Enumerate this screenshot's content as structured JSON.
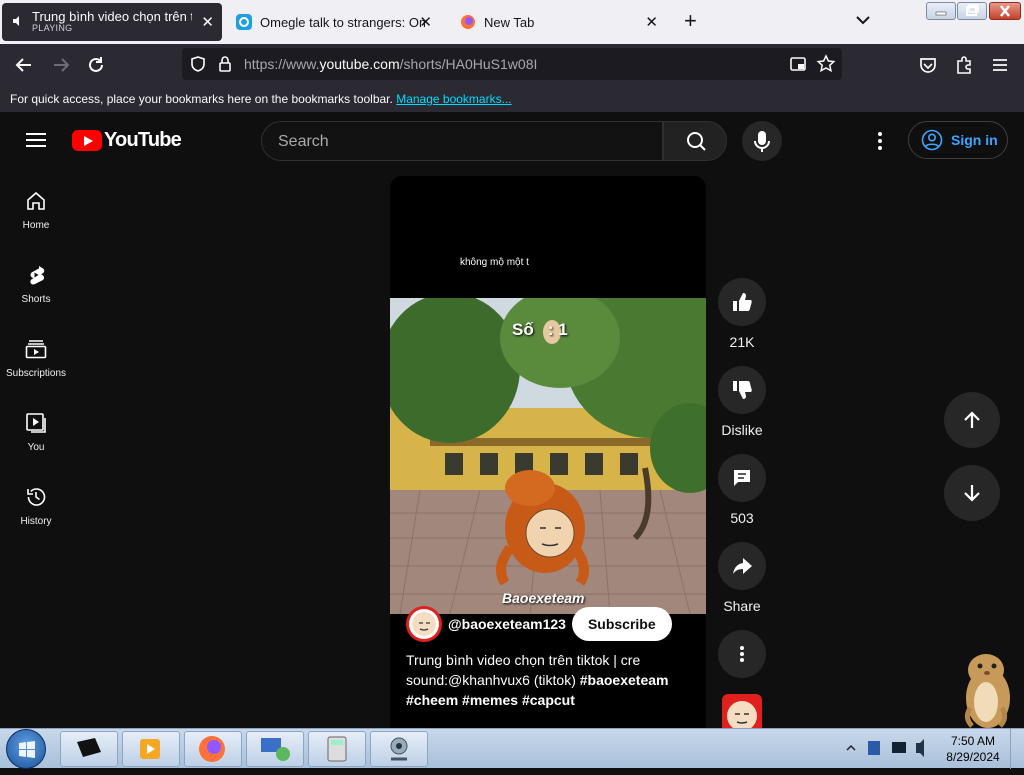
{
  "browser": {
    "tabs": [
      {
        "title": "Trung bình video chọn trên tik",
        "status": "PLAYING",
        "active": true
      },
      {
        "title": "Omegle talk to strangers: Omeg",
        "active": false
      },
      {
        "title": "New Tab",
        "active": false
      }
    ],
    "new_tab_label": "+",
    "url_prefix": "https://www.",
    "url_host": "youtube.com",
    "url_path": "/shorts/HA0HuS1w08I",
    "bookmarks_hint": "For quick access, place your bookmarks here on the bookmarks toolbar.",
    "manage_bookmarks": "Manage bookmarks..."
  },
  "youtube": {
    "logo_text": "YouTube",
    "search_placeholder": "Search",
    "sign_in": "Sign in",
    "sidebar": [
      {
        "label": "Home",
        "icon": "home-icon"
      },
      {
        "label": "Shorts",
        "icon": "shorts-icon"
      },
      {
        "label": "Subscriptions",
        "icon": "subscriptions-icon"
      },
      {
        "label": "You",
        "icon": "you-icon"
      },
      {
        "label": "History",
        "icon": "history-icon"
      }
    ],
    "short": {
      "caption_top": "không mộ một t",
      "score_text": "Số",
      "score_value": ": 1",
      "watermark": "Baoexeteam",
      "channel": "@baoexeteam123",
      "subscribe": "Subscribe",
      "description_text": "Trung bình video chọn trên tiktok | cre sound:@khanhvux6 (tiktok)",
      "hashtags": "#baoexeteam #cheem #memes #capcut"
    },
    "actions": {
      "likes": "21K",
      "dislike": "Dislike",
      "comments": "503",
      "share": "Share"
    }
  },
  "taskbar": {
    "time": "7:50 AM",
    "date": "8/29/2024"
  },
  "colors": {
    "youtube_red": "#ff0000",
    "link_blue": "#3ea6ff",
    "background": "#0f0f0f"
  }
}
